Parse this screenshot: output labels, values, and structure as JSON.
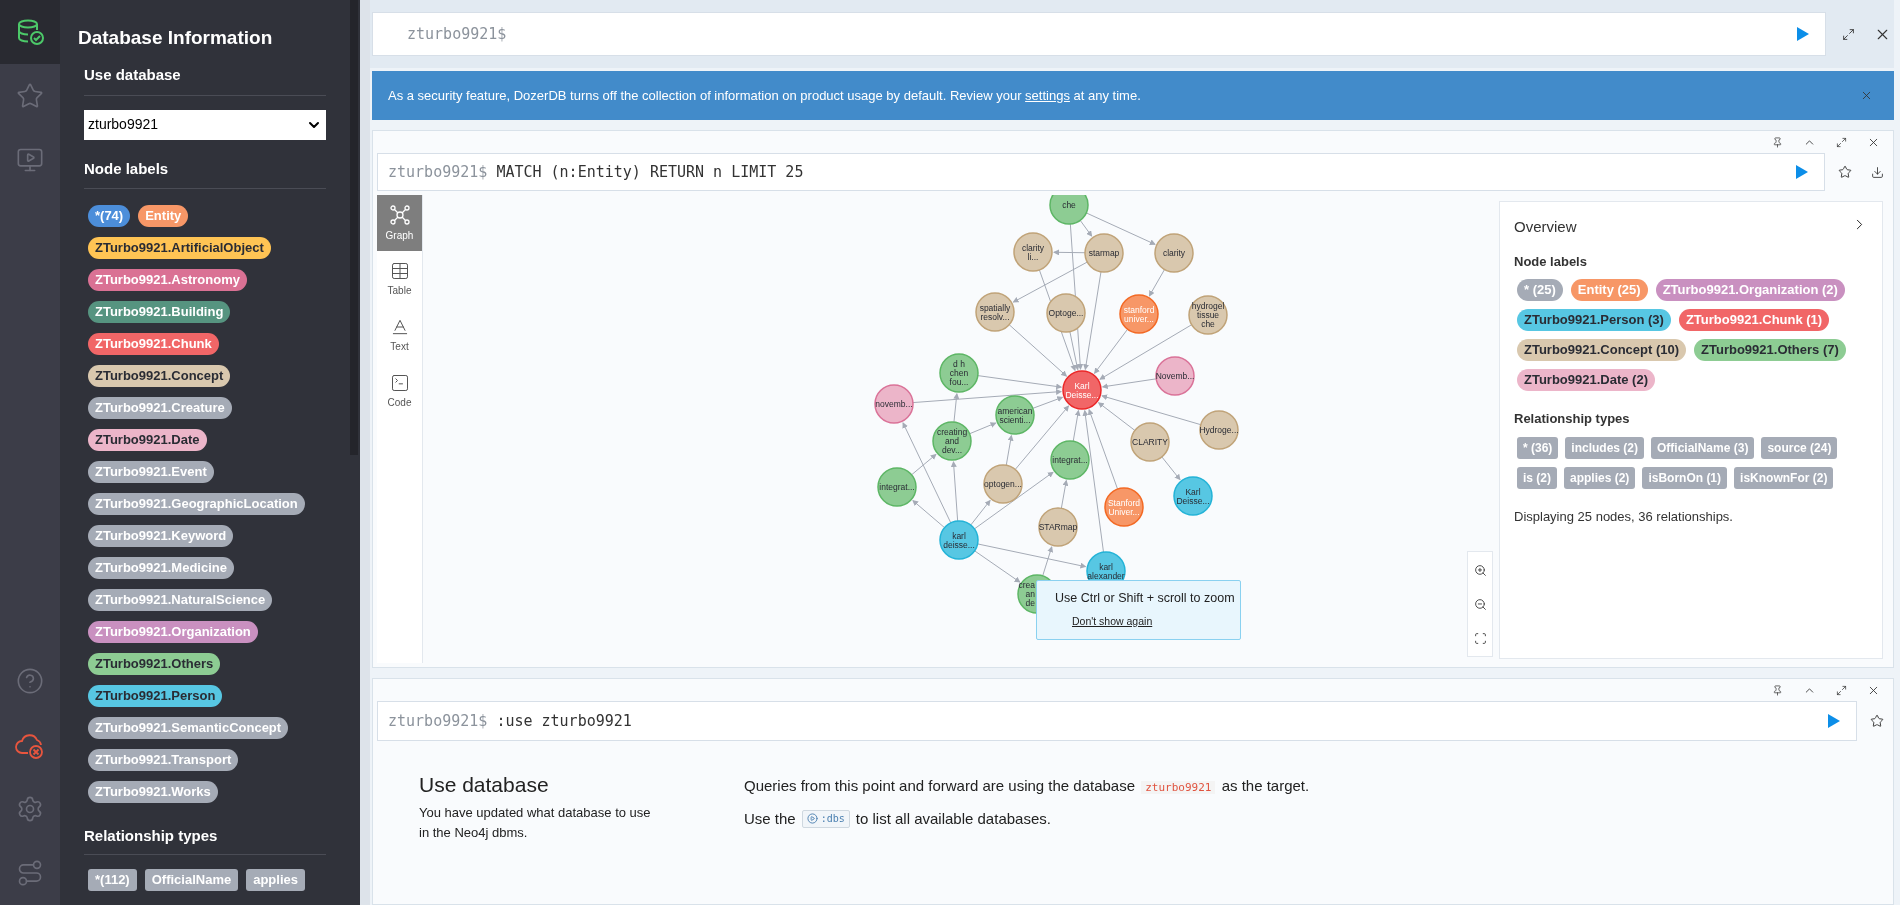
{
  "rail": {
    "top": [
      {
        "selected": true
      },
      {
        "selected": false
      },
      {
        "selected": false
      }
    ],
    "connected": false
  },
  "sidebar": {
    "title": "Database Information",
    "use_database": {
      "heading": "Use database",
      "value": "zturbo9921"
    },
    "node_labels": {
      "heading": "Node labels",
      "rows": [
        [
          {
            "label": "*(74)",
            "color": "#4c8eda",
            "dark_text": false
          },
          {
            "label": "Entity",
            "color": "#f79767",
            "dark_text": false
          }
        ],
        [
          {
            "label": "ZTurbo9921.ArtificialObject",
            "color": "#ffc454",
            "dark_text": true
          }
        ],
        [
          {
            "label": "ZTurbo9921.Astronomy",
            "color": "#da7194",
            "dark_text": false
          }
        ],
        [
          {
            "label": "ZTurbo9921.Building",
            "color": "#569480",
            "dark_text": false
          }
        ],
        [
          {
            "label": "ZTurbo9921.Chunk",
            "color": "#f16667",
            "dark_text": false
          }
        ],
        [
          {
            "label": "ZTurbo9921.Concept",
            "color": "#d9c8ae",
            "dark_text": true
          }
        ],
        [
          {
            "label": "ZTurbo9921.Creature",
            "color": "#a5abb6",
            "dark_text": false
          }
        ],
        [
          {
            "label": "ZTurbo9921.Date",
            "color": "#ecb5c9",
            "dark_text": true
          }
        ],
        [
          {
            "label": "ZTurbo9921.Event",
            "color": "#a5abb6",
            "dark_text": false
          }
        ],
        [
          {
            "label": "ZTurbo9921.GeographicLocation",
            "color": "#a5abb6",
            "dark_text": false
          }
        ],
        [
          {
            "label": "ZTurbo9921.Keyword",
            "color": "#a5abb6",
            "dark_text": false
          }
        ],
        [
          {
            "label": "ZTurbo9921.Medicine",
            "color": "#a5abb6",
            "dark_text": false
          }
        ],
        [
          {
            "label": "ZTurbo9921.NaturalScience",
            "color": "#a5abb6",
            "dark_text": false
          }
        ],
        [
          {
            "label": "ZTurbo9921.Organization",
            "color": "#c990c0",
            "dark_text": false
          }
        ],
        [
          {
            "label": "ZTurbo9921.Others",
            "color": "#8dcc93",
            "dark_text": true
          }
        ],
        [
          {
            "label": "ZTurbo9921.Person",
            "color": "#57c7e3",
            "dark_text": true
          }
        ],
        [
          {
            "label": "ZTurbo9921.SemanticConcept",
            "color": "#a5abb6",
            "dark_text": false
          }
        ],
        [
          {
            "label": "ZTurbo9921.Transport",
            "color": "#a5abb6",
            "dark_text": false
          }
        ],
        [
          {
            "label": "ZTurbo9921.Works",
            "color": "#a5abb6",
            "dark_text": false
          }
        ]
      ]
    },
    "relationship_types": {
      "heading": "Relationship types",
      "items": [
        "*(112)",
        "OfficialName",
        "applies"
      ]
    }
  },
  "top_editor": {
    "prompt": "zturbo9921$"
  },
  "banner": {
    "text": "As a security feature, DozerDB turns off the collection of information on product usage by default. Review your",
    "link": "settings",
    "text_after": "at any time."
  },
  "result_frame": {
    "prompt": "zturbo9921$",
    "query": "MATCH (n:Entity) RETURN n LIMIT 25",
    "view_tabs": [
      {
        "label": "Graph",
        "selected": true
      },
      {
        "label": "Table",
        "selected": false
      },
      {
        "label": "Text",
        "selected": false
      },
      {
        "label": "Code",
        "selected": false
      }
    ],
    "graph": {
      "nodes": [
        {
          "caption": [
            "che"
          ],
          "color": "#8dcc93",
          "kind": "other"
        },
        {
          "caption": [
            "clarity",
            "li..."
          ],
          "color": "#d9c8ae",
          "kind": "concept"
        },
        {
          "caption": [
            "starmap"
          ],
          "color": "#d9c8ae",
          "kind": "concept"
        },
        {
          "caption": [
            "clarity"
          ],
          "color": "#d9c8ae",
          "kind": "concept"
        },
        {
          "caption": [
            "spatially",
            "resolv..."
          ],
          "color": "#d9c8ae",
          "kind": "concept"
        },
        {
          "caption": [
            "Optoge..."
          ],
          "color": "#d9c8ae",
          "kind": "concept"
        },
        {
          "caption": [
            "stanford",
            "univer..."
          ],
          "color": "#f79767",
          "kind": "entity"
        },
        {
          "caption": [
            "hydrogel",
            "tissue",
            "che"
          ],
          "color": "#d9c8ae",
          "kind": "concept"
        },
        {
          "caption": [
            "Karl",
            "Deisse..."
          ],
          "color": "#f16667",
          "kind": "chunk"
        },
        {
          "caption": [
            "Novemb..."
          ],
          "color": "#ecb5c9",
          "kind": "date"
        },
        {
          "caption": [
            "d h",
            "chen",
            "fou..."
          ],
          "color": "#8dcc93",
          "kind": "other"
        },
        {
          "caption": [
            "novemb..."
          ],
          "color": "#ecb5c9",
          "kind": "date"
        },
        {
          "caption": [
            "american",
            "scienti..."
          ],
          "color": "#8dcc93",
          "kind": "other"
        },
        {
          "caption": [
            "creating",
            "and",
            "dev..."
          ],
          "color": "#8dcc93",
          "kind": "other"
        },
        {
          "caption": [
            "Hydroge..."
          ],
          "color": "#d9c8ae",
          "kind": "concept"
        },
        {
          "caption": [
            "CLARITY"
          ],
          "color": "#d9c8ae",
          "kind": "concept"
        },
        {
          "caption": [
            "integrat..."
          ],
          "color": "#8dcc93",
          "kind": "other"
        },
        {
          "caption": [
            "integrat..."
          ],
          "color": "#8dcc93",
          "kind": "other"
        },
        {
          "caption": [
            "optogen..."
          ],
          "color": "#d9c8ae",
          "kind": "concept"
        },
        {
          "caption": [
            "Karl",
            "Deisse..."
          ],
          "color": "#57c7e3",
          "kind": "person"
        },
        {
          "caption": [
            "STARmap"
          ],
          "color": "#d9c8ae",
          "kind": "concept"
        },
        {
          "caption": [
            "Stanford",
            "Univer..."
          ],
          "color": "#f79767",
          "kind": "entity"
        },
        {
          "caption": [
            "karl",
            "deisse..."
          ],
          "color": "#57c7e3",
          "kind": "person"
        },
        {
          "caption": [
            "karl",
            "alexander"
          ],
          "color": "#57c7e3",
          "kind": "person"
        },
        {
          "caption": [
            "crea",
            "an",
            "de"
          ],
          "color": "#8dcc93",
          "kind": "other"
        }
      ],
      "edges_drawn": true
    },
    "zoom_hint": {
      "text": "Use Ctrl or Shift + scroll to zoom",
      "link": "Don't show again"
    },
    "overview": {
      "title": "Overview",
      "node_labels_heading": "Node labels",
      "node_labels": [
        {
          "label": "* (25)",
          "color": "#a5abb6",
          "dark_text": false
        },
        {
          "label": "Entity (25)",
          "color": "#f79767",
          "dark_text": false
        },
        {
          "label": "ZTurbo9921.Organization (2)",
          "color": "#c990c0",
          "dark_text": false
        },
        {
          "label": "ZTurbo9921.Person (3)",
          "color": "#57c7e3",
          "dark_text": true
        },
        {
          "label": "ZTurbo9921.Chunk (1)",
          "color": "#f16667",
          "dark_text": false
        },
        {
          "label": "ZTurbo9921.Concept (10)",
          "color": "#d9c8ae",
          "dark_text": true
        },
        {
          "label": "ZTurbo9921.Others (7)",
          "color": "#8dcc93",
          "dark_text": true
        },
        {
          "label": "ZTurbo9921.Date (2)",
          "color": "#ecb5c9",
          "dark_text": true
        }
      ],
      "relationship_types_heading": "Relationship types",
      "relationship_types": [
        "* (36)",
        "includes (2)",
        "OfficialName (3)",
        "source (24)",
        "is (2)",
        "applies (2)",
        "isBornOn (1)",
        "isKnownFor (2)"
      ],
      "summary": "Displaying 25 nodes, 36 relationships."
    }
  },
  "use_frame": {
    "prompt": "zturbo9921$",
    "query": ":use zturbo9921",
    "title": "Use database",
    "description": "You have updated what database to use in the Neo4j dbms.",
    "line_1_before": "Queries from this point and forward are using the database",
    "database": "zturbo9921",
    "line_1_after": "as the target.",
    "line_2_before": "Use the",
    "command": ":dbs",
    "line_2_after": "to list all available databases."
  }
}
